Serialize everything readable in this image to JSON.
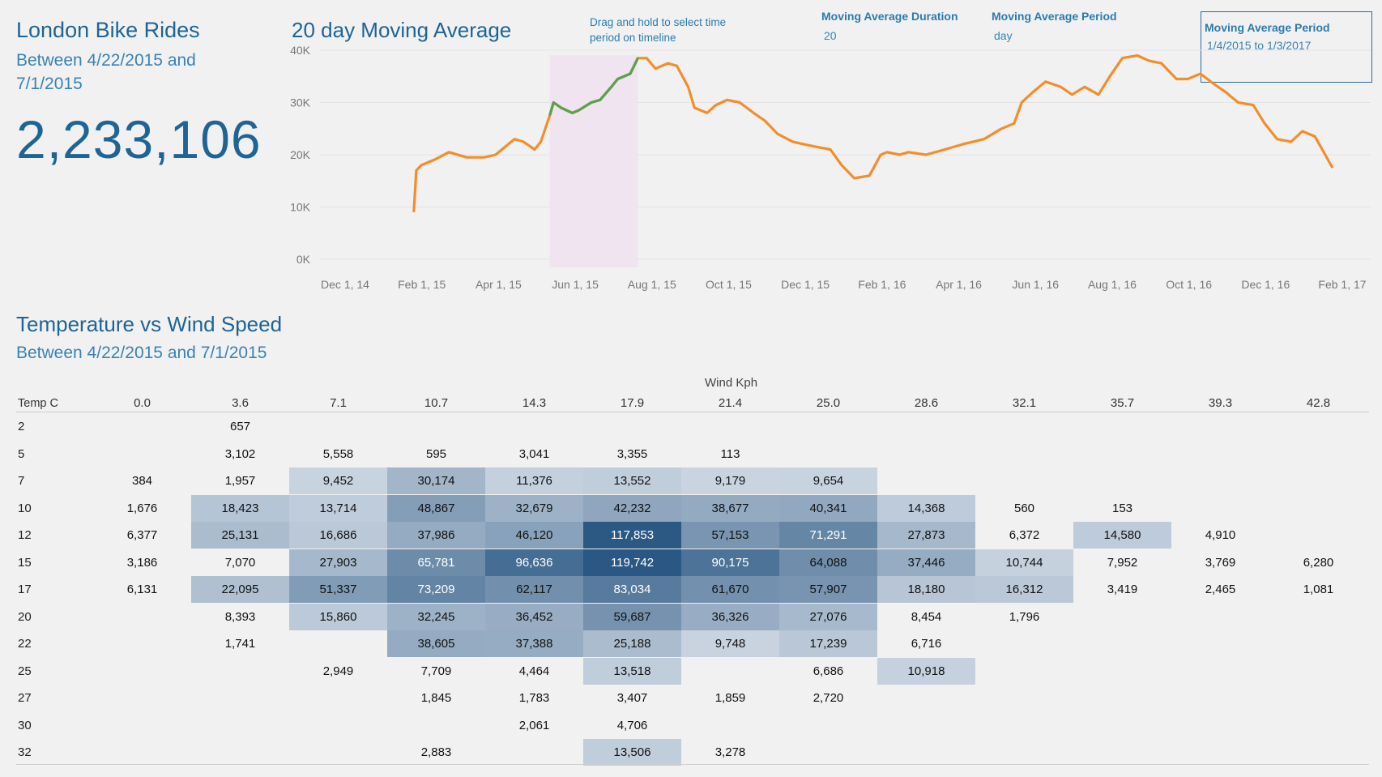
{
  "kpi": {
    "title": "London Bike Rides",
    "subtitle": " Between 4/22/2015 and 7/1/2015",
    "total": "2,233,106"
  },
  "moving_avg": {
    "title": "20 day Moving Average",
    "hint": "Drag and hold to select time period on timeline",
    "duration_label": "Moving Average Duration",
    "duration_value": "20",
    "period_label": "Moving Average Period",
    "period_value": "day",
    "range_label": "Moving Average Period",
    "range_value": "1/4/2015 to 1/3/2017"
  },
  "heatmap": {
    "title": "Temperature vs Wind Speed",
    "subtitle": "Between 4/22/2015 and 7/1/2015",
    "x_label": "Wind Kph",
    "row_header": "Temp C"
  },
  "colors": {
    "line": "#f28e2b",
    "highlight_line": "#59a14f",
    "selection_band": "#efe4f0",
    "heat_low": "#e4e9f0",
    "heat_high": "#2a5783"
  },
  "chart_data": [
    {
      "type": "line",
      "title": "20 day Moving Average",
      "x_ticks": [
        "Dec 1, 14",
        "Feb 1, 15",
        "Apr 1, 15",
        "Jun 1, 15",
        "Aug 1, 15",
        "Oct 1, 15",
        "Dec 1, 15",
        "Feb 1, 16",
        "Apr 1, 16",
        "Jun 1, 16",
        "Aug 1, 16",
        "Oct 1, 16",
        "Dec 1, 16",
        "Feb 1, 17"
      ],
      "y_ticks": [
        "0K",
        "10K",
        "20K",
        "30K",
        "40K"
      ],
      "ylim": [
        0,
        40000
      ],
      "xlim": [
        "2014-12-01",
        "2017-02-01"
      ],
      "selection": [
        "2015-04-22",
        "2015-07-01"
      ],
      "series": [
        {
          "x": [
            "2015-01-04",
            "2015-01-06",
            "2015-01-10",
            "2015-01-20",
            "2015-02-01",
            "2015-02-15",
            "2015-03-01",
            "2015-03-10",
            "2015-03-20",
            "2015-03-25",
            "2015-04-01",
            "2015-04-10",
            "2015-04-15",
            "2015-04-22",
            "2015-04-25",
            "2015-05-01",
            "2015-05-10",
            "2015-05-15",
            "2015-05-25",
            "2015-06-01",
            "2015-06-10",
            "2015-06-15",
            "2015-06-25",
            "2015-07-01",
            "2015-07-08",
            "2015-07-15",
            "2015-07-25",
            "2015-08-01",
            "2015-08-10",
            "2015-08-15",
            "2015-08-25",
            "2015-09-01",
            "2015-09-10",
            "2015-09-20",
            "2015-10-01",
            "2015-10-10",
            "2015-10-20",
            "2015-11-01",
            "2015-11-10",
            "2015-11-20",
            "2015-12-01",
            "2015-12-10",
            "2015-12-20",
            "2016-01-01",
            "2016-01-10",
            "2016-01-15",
            "2016-01-25",
            "2016-02-01",
            "2016-02-15",
            "2016-03-01",
            "2016-03-15",
            "2016-04-01",
            "2016-04-15",
            "2016-04-25",
            "2016-05-01",
            "2016-05-10",
            "2016-05-20",
            "2016-06-01",
            "2016-06-10",
            "2016-06-20",
            "2016-07-01",
            "2016-07-10",
            "2016-07-20",
            "2016-08-01",
            "2016-08-10",
            "2016-08-20",
            "2016-09-01",
            "2016-09-10",
            "2016-09-20",
            "2016-10-01",
            "2016-10-10",
            "2016-10-20",
            "2016-11-01",
            "2016-11-10",
            "2016-11-20",
            "2016-12-01",
            "2016-12-10",
            "2016-12-20",
            "2017-01-03"
          ],
          "values": [
            9000,
            17000,
            18000,
            19000,
            20500,
            19500,
            19500,
            20000,
            22000,
            23000,
            22500,
            21000,
            22500,
            27500,
            30000,
            29000,
            28000,
            28500,
            30000,
            30500,
            33000,
            34500,
            35500,
            38500,
            38500,
            36500,
            37500,
            37000,
            33000,
            29000,
            28000,
            29500,
            30500,
            30000,
            28000,
            26500,
            24000,
            22500,
            22000,
            21500,
            21000,
            18000,
            15500,
            16000,
            20000,
            20500,
            20000,
            20500,
            20000,
            21000,
            22000,
            23000,
            25000,
            26000,
            30000,
            32000,
            34000,
            33000,
            31500,
            33000,
            31500,
            35000,
            38500,
            39000,
            38000,
            37500,
            34500,
            34500,
            35500,
            33500,
            32000,
            30000,
            29500,
            26000,
            23000,
            22500,
            24500,
            23500,
            17500
          ]
        }
      ]
    },
    {
      "type": "heatmap",
      "title": "Temperature vs Wind Speed",
      "xlabel": "Wind Kph",
      "ylabel": "Temp C",
      "x": [
        "0.0",
        "3.6",
        "7.1",
        "10.7",
        "14.3",
        "17.9",
        "21.4",
        "25.0",
        "28.6",
        "32.1",
        "35.7",
        "39.3",
        "42.8"
      ],
      "y": [
        "2",
        "5",
        "7",
        "10",
        "12",
        "15",
        "17",
        "20",
        "22",
        "25",
        "27",
        "30",
        "32"
      ],
      "values": [
        [
          null,
          657,
          null,
          null,
          null,
          null,
          null,
          null,
          null,
          null,
          null,
          null,
          null
        ],
        [
          null,
          3102,
          5558,
          595,
          3041,
          3355,
          113,
          null,
          null,
          null,
          null,
          null,
          null
        ],
        [
          384,
          1957,
          9452,
          30174,
          11376,
          13552,
          9179,
          9654,
          null,
          null,
          null,
          null,
          null
        ],
        [
          1676,
          18423,
          13714,
          48867,
          32679,
          42232,
          38677,
          40341,
          14368,
          560,
          153,
          null,
          null
        ],
        [
          6377,
          25131,
          16686,
          37986,
          46120,
          117853,
          57153,
          71291,
          27873,
          6372,
          14580,
          4910,
          null
        ],
        [
          3186,
          7070,
          27903,
          65781,
          96636,
          119742,
          90175,
          64088,
          37446,
          10744,
          7952,
          3769,
          6280
        ],
        [
          6131,
          22095,
          51337,
          73209,
          62117,
          83034,
          61670,
          57907,
          18180,
          16312,
          3419,
          2465,
          1081
        ],
        [
          null,
          8393,
          15860,
          32245,
          36452,
          59687,
          36326,
          27076,
          8454,
          1796,
          null,
          null,
          null
        ],
        [
          null,
          1741,
          null,
          38605,
          37388,
          25188,
          9748,
          17239,
          6716,
          null,
          null,
          null,
          null
        ],
        [
          null,
          null,
          2949,
          7709,
          4464,
          13518,
          null,
          6686,
          10918,
          null,
          null,
          null,
          null
        ],
        [
          null,
          null,
          null,
          1845,
          1783,
          3407,
          1859,
          2720,
          null,
          null,
          null,
          null,
          null
        ],
        [
          null,
          null,
          null,
          null,
          2061,
          4706,
          null,
          null,
          null,
          null,
          null,
          null,
          null
        ],
        [
          null,
          null,
          null,
          2883,
          null,
          13506,
          3278,
          null,
          null,
          null,
          null,
          null,
          null
        ]
      ]
    }
  ]
}
